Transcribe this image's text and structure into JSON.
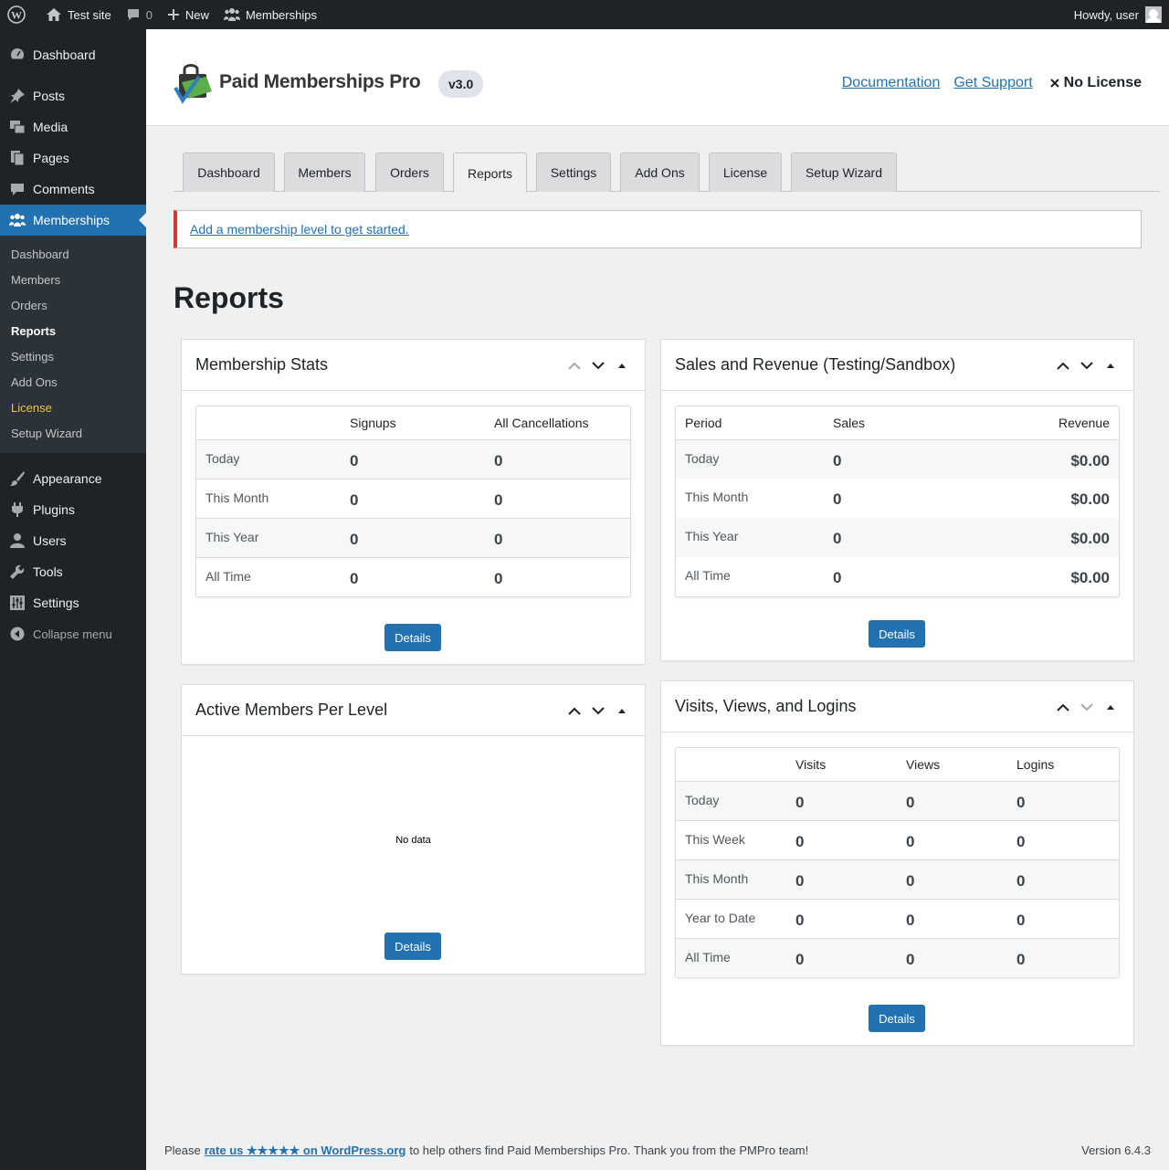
{
  "adminbar": {
    "site_name": "Test site",
    "comments_count": "0",
    "new_label": "New",
    "memberships_label": "Memberships",
    "howdy": "Howdy, user"
  },
  "sidebar": {
    "items_top": [
      {
        "label": "Dashboard",
        "icon": "dashboard-icon"
      },
      {
        "label": "Posts",
        "icon": "pin-icon"
      },
      {
        "label": "Media",
        "icon": "media-icon"
      },
      {
        "label": "Pages",
        "icon": "pages-icon"
      },
      {
        "label": "Comments",
        "icon": "comment-icon"
      },
      {
        "label": "Memberships",
        "icon": "groups-icon"
      }
    ],
    "submenu": [
      "Dashboard",
      "Members",
      "Orders",
      "Reports",
      "Settings",
      "Add Ons",
      "License",
      "Setup Wizard"
    ],
    "items_bottom": [
      {
        "label": "Appearance",
        "icon": "brush-icon"
      },
      {
        "label": "Plugins",
        "icon": "plugin-icon"
      },
      {
        "label": "Users",
        "icon": "user-icon"
      },
      {
        "label": "Tools",
        "icon": "wrench-icon"
      },
      {
        "label": "Settings",
        "icon": "sliders-icon"
      }
    ],
    "collapse_label": "Collapse menu"
  },
  "header": {
    "logo_text": "Paid Memberships Pro",
    "version": "v3.0",
    "documentation": "Documentation",
    "support": "Get Support",
    "license": "No License"
  },
  "tabs": [
    "Dashboard",
    "Members",
    "Orders",
    "Reports",
    "Settings",
    "Add Ons",
    "License",
    "Setup Wizard"
  ],
  "active_tab": "Reports",
  "notice": "Add a membership level to get started.",
  "page_title": "Reports",
  "membership_stats": {
    "title": "Membership Stats",
    "headers": [
      "",
      "Signups",
      "All Cancellations"
    ],
    "rows": [
      {
        "label": "Today",
        "signups": "0",
        "cancellations": "0"
      },
      {
        "label": "This Month",
        "signups": "0",
        "cancellations": "0"
      },
      {
        "label": "This Year",
        "signups": "0",
        "cancellations": "0"
      },
      {
        "label": "All Time",
        "signups": "0",
        "cancellations": "0"
      }
    ],
    "details": "Details"
  },
  "sales": {
    "title": "Sales and Revenue (Testing/Sandbox)",
    "headers": [
      "Period",
      "Sales",
      "Revenue"
    ],
    "rows": [
      {
        "label": "Today",
        "sales": "0",
        "revenue": "$0.00"
      },
      {
        "label": "This Month",
        "sales": "0",
        "revenue": "$0.00"
      },
      {
        "label": "This Year",
        "sales": "0",
        "revenue": "$0.00"
      },
      {
        "label": "All Time",
        "sales": "0",
        "revenue": "$0.00"
      }
    ],
    "details": "Details"
  },
  "active_members": {
    "title": "Active Members Per Level",
    "no_data": "No data",
    "details": "Details"
  },
  "visits": {
    "title": "Visits, Views, and Logins",
    "headers": [
      "",
      "Visits",
      "Views",
      "Logins"
    ],
    "rows": [
      {
        "label": "Today",
        "visits": "0",
        "views": "0",
        "logins": "0"
      },
      {
        "label": "This Week",
        "visits": "0",
        "views": "0",
        "logins": "0"
      },
      {
        "label": "This Month",
        "visits": "0",
        "views": "0",
        "logins": "0"
      },
      {
        "label": "Year to Date",
        "visits": "0",
        "views": "0",
        "logins": "0"
      },
      {
        "label": "All Time",
        "visits": "0",
        "views": "0",
        "logins": "0"
      }
    ],
    "details": "Details"
  },
  "footer": {
    "prefix": "Please",
    "rate_link": "rate us ★★★★★ on WordPress.org",
    "suffix": "to help others find Paid Memberships Pro. Thank you from the PMPro team!",
    "version": "Version 6.4.3"
  }
}
